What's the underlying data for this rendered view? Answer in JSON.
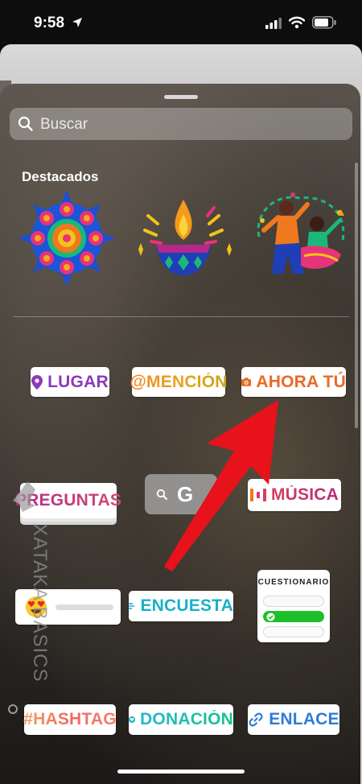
{
  "status_bar": {
    "time": "9:58"
  },
  "sheet": {
    "search": {
      "placeholder": "Buscar"
    },
    "section_title": "Destacados",
    "featured": [
      {
        "name": "mandala-sticker"
      },
      {
        "name": "diya-lamp-sticker"
      },
      {
        "name": "dancers-sticker"
      }
    ],
    "stickers": {
      "location": "LUGAR",
      "mention": "@MENCIÓN",
      "your_turn": "AHORA TÚ",
      "questions": "PREGUNTAS",
      "gif_letter": "G",
      "music": "MÚSICA",
      "poll": "ENCUESTA",
      "quiz_title": "CUESTIONARIO",
      "hashtag": "#HASHTAG",
      "donation": "DONACIÓN",
      "link": "ENLACE"
    }
  },
  "watermark": {
    "text": "XATAKA BASICS"
  },
  "colors": {
    "arrow": "#e8121b",
    "location": "#8a3ab9",
    "your_turn": "#e96a28",
    "poll": "#1ab0c8",
    "link": "#2f7dd6",
    "quiz_selected": "#1dbf2a"
  }
}
